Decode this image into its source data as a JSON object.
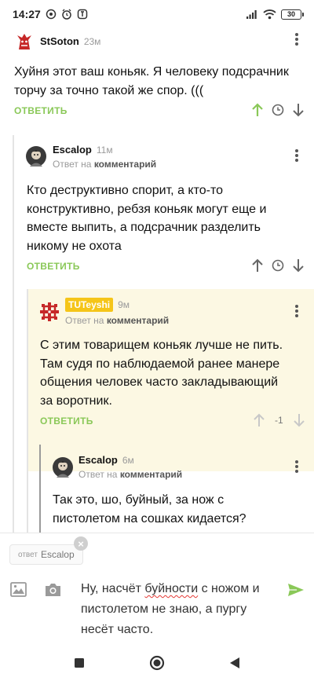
{
  "status_bar": {
    "time": "14:27",
    "battery": "30"
  },
  "comments": [
    {
      "author": "StSoton",
      "time": "23м",
      "text": "Хуйня этот ваш коньяк. Я человеку подсрачник торчу за точно такой же спор. (((",
      "reply_label": "ОТВЕТИТЬ"
    },
    {
      "author": "Escalop",
      "time": "11м",
      "reply_prefix": "Ответ на",
      "reply_target": "комментарий",
      "text": "Кто деструктивно спорит, а кто-то конструктивно, ребзя коньяк могут еще и вместе выпить, а подсрачник разделить никому не охота",
      "reply_label": "ОТВЕТИТЬ"
    },
    {
      "author": "TUTeyshi",
      "time": "9м",
      "reply_prefix": "Ответ на",
      "reply_target": "комментарий",
      "text": "С этим товарищем коньяк лучше не пить. Там судя по наблюдаемой ранее манере общения человек часто закладывающий за воротник.",
      "reply_label": "ОТВЕТИТЬ",
      "rating": "-1"
    },
    {
      "author": "Escalop",
      "time": "6м",
      "reply_prefix": "Ответ на",
      "reply_target": "комментарий",
      "text": "Так это, шо, буйный, за нож с пистолетом на сошках кидается?"
    }
  ],
  "reply_box": {
    "chip_label": "ответ",
    "chip_name": "Escalop",
    "text_before": "Ну, насчёт ",
    "text_misspelled": "буйности",
    "text_after": " с ножом и пистолетом не знаю, а пургу несёт часто."
  },
  "colors": {
    "accent_green": "#8ac858",
    "highlight_bg": "#fcf8e3",
    "badge_yellow": "#f5c518"
  },
  "icons": [
    "wifi-icon",
    "signal-icon",
    "alarm-icon",
    "kebab-icon",
    "upvote-icon",
    "clock-icon",
    "downvote-icon",
    "image-icon",
    "camera-icon",
    "send-icon",
    "stop-icon",
    "home-icon",
    "back-icon"
  ]
}
